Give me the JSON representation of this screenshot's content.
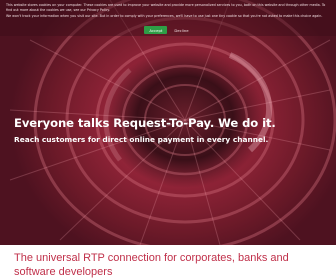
{
  "cookie_banner": {
    "paragraph_1": "This website stores cookies on your computer. These cookies are used to improve your website and provide more personalized services to you, both on this website and through other media. To find out more about the cookies we use, see our Privacy Policy.",
    "paragraph_2": "We won't track your information when you visit our site. But in order to comply with your preferences, we'll have to use just one tiny cookie so that you're not asked to make this choice again.",
    "accept_label": "Accept",
    "reject_label": "Decline"
  },
  "hero": {
    "headline": "Everyone talks Request-To-Pay. We do it.",
    "subheadline": "Reach customers for direct online payment in every channel."
  },
  "tagline": "The universal RTP connection for corporates, banks and software developers",
  "colors": {
    "brand_red": "#c0304a",
    "accept_green": "#2e9e46"
  }
}
